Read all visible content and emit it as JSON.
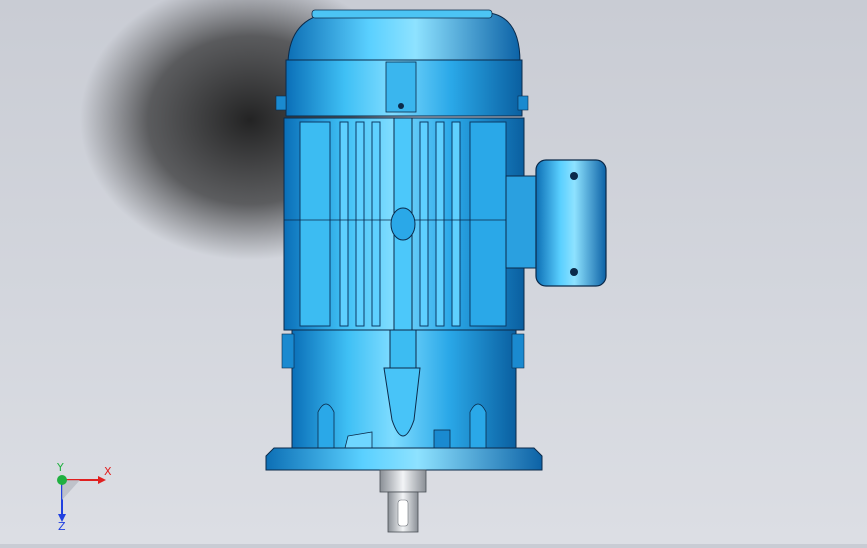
{
  "viewport": {
    "background_top": "#c9ccd4",
    "background_bottom": "#dcdee4",
    "model_color": "#1e9fe0",
    "model_highlight": "#6fd6ff",
    "model_shadow": "#0a5fa0",
    "edge_color": "#0b2a4a"
  },
  "triad": {
    "x_label": "X",
    "y_label": "Y",
    "z_label": "Z",
    "x_color": "#e02020",
    "y_color": "#20b040",
    "z_color": "#2040e0"
  }
}
